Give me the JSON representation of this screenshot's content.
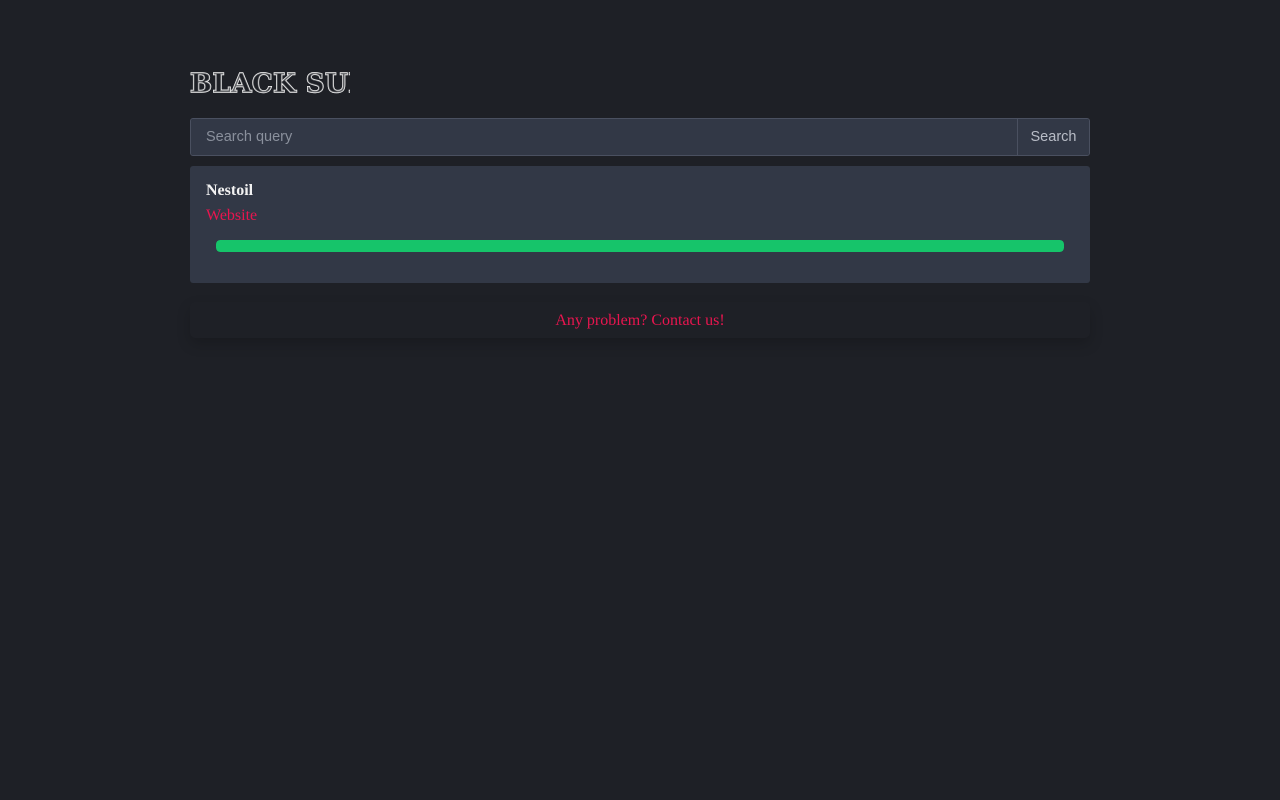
{
  "brand": {
    "name": "BLACK SUIT"
  },
  "search": {
    "placeholder": "Search query",
    "value": "",
    "button_label": "Search"
  },
  "results": [
    {
      "name": "Nestoil",
      "link_label": "Website",
      "progress_percent": 100,
      "progress_color": "#16c46a"
    }
  ],
  "footer": {
    "contact_label": "Any problem? Contact us!"
  },
  "colors": {
    "background": "#1e2026",
    "card": "#323846",
    "accent_link": "#e8154f",
    "progress": "#16c46a"
  }
}
